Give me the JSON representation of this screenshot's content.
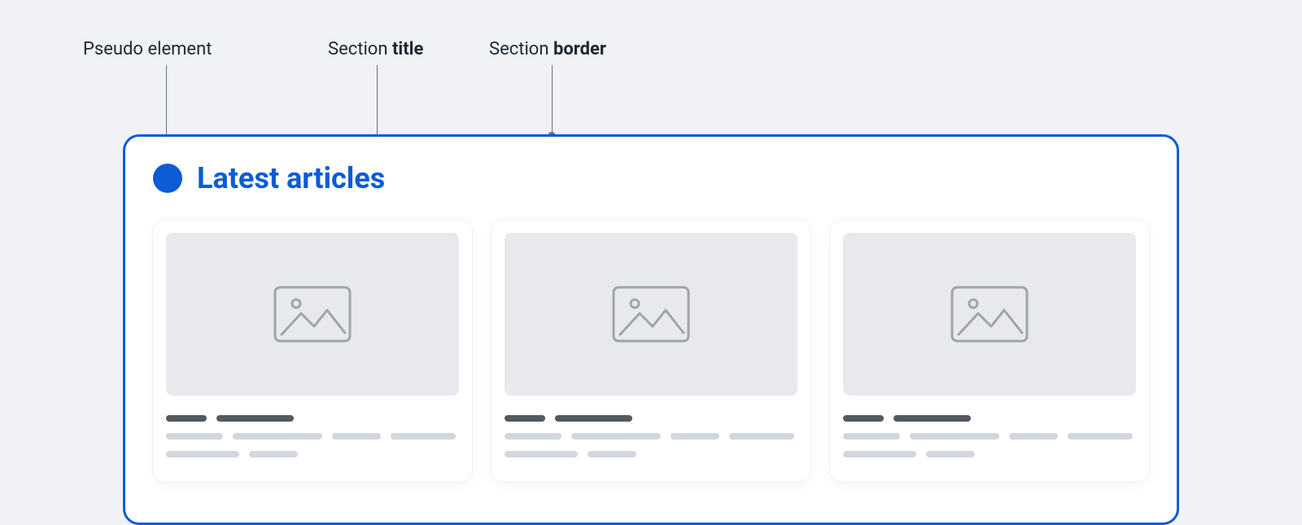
{
  "annotations": [
    {
      "label_plain": "Pseudo element",
      "label_bold": ""
    },
    {
      "label_plain": "Section ",
      "label_bold": "title"
    },
    {
      "label_plain": "Section ",
      "label_bold": "border"
    }
  ],
  "section": {
    "title": "Latest articles"
  },
  "cards": [
    {
      "id": "article-1"
    },
    {
      "id": "article-2"
    },
    {
      "id": "article-3"
    }
  ]
}
